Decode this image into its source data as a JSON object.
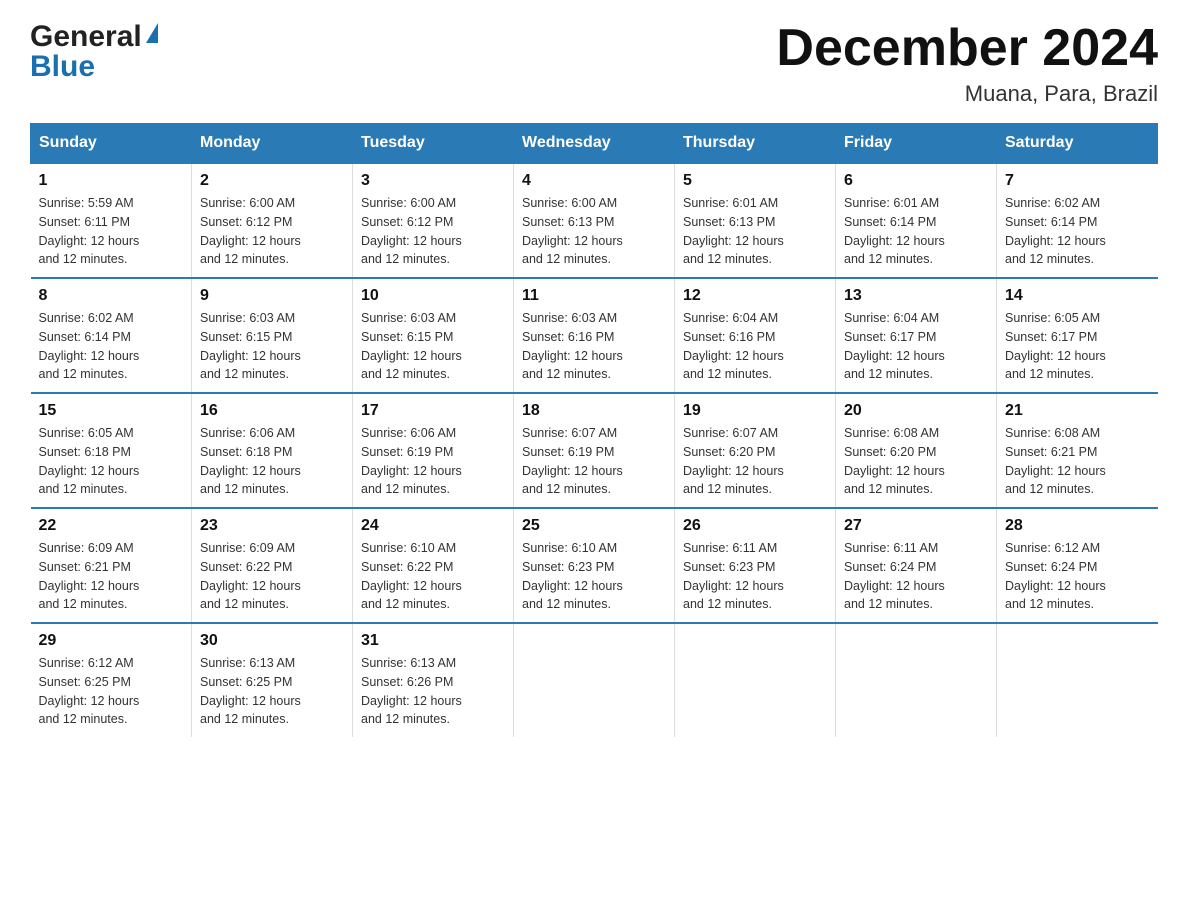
{
  "logo": {
    "line1": "General",
    "line2": "Blue"
  },
  "title": "December 2024",
  "subtitle": "Muana, Para, Brazil",
  "days_of_week": [
    "Sunday",
    "Monday",
    "Tuesday",
    "Wednesday",
    "Thursday",
    "Friday",
    "Saturday"
  ],
  "weeks": [
    [
      {
        "day": "1",
        "info": "Sunrise: 5:59 AM\nSunset: 6:11 PM\nDaylight: 12 hours\nand 12 minutes."
      },
      {
        "day": "2",
        "info": "Sunrise: 6:00 AM\nSunset: 6:12 PM\nDaylight: 12 hours\nand 12 minutes."
      },
      {
        "day": "3",
        "info": "Sunrise: 6:00 AM\nSunset: 6:12 PM\nDaylight: 12 hours\nand 12 minutes."
      },
      {
        "day": "4",
        "info": "Sunrise: 6:00 AM\nSunset: 6:13 PM\nDaylight: 12 hours\nand 12 minutes."
      },
      {
        "day": "5",
        "info": "Sunrise: 6:01 AM\nSunset: 6:13 PM\nDaylight: 12 hours\nand 12 minutes."
      },
      {
        "day": "6",
        "info": "Sunrise: 6:01 AM\nSunset: 6:14 PM\nDaylight: 12 hours\nand 12 minutes."
      },
      {
        "day": "7",
        "info": "Sunrise: 6:02 AM\nSunset: 6:14 PM\nDaylight: 12 hours\nand 12 minutes."
      }
    ],
    [
      {
        "day": "8",
        "info": "Sunrise: 6:02 AM\nSunset: 6:14 PM\nDaylight: 12 hours\nand 12 minutes."
      },
      {
        "day": "9",
        "info": "Sunrise: 6:03 AM\nSunset: 6:15 PM\nDaylight: 12 hours\nand 12 minutes."
      },
      {
        "day": "10",
        "info": "Sunrise: 6:03 AM\nSunset: 6:15 PM\nDaylight: 12 hours\nand 12 minutes."
      },
      {
        "day": "11",
        "info": "Sunrise: 6:03 AM\nSunset: 6:16 PM\nDaylight: 12 hours\nand 12 minutes."
      },
      {
        "day": "12",
        "info": "Sunrise: 6:04 AM\nSunset: 6:16 PM\nDaylight: 12 hours\nand 12 minutes."
      },
      {
        "day": "13",
        "info": "Sunrise: 6:04 AM\nSunset: 6:17 PM\nDaylight: 12 hours\nand 12 minutes."
      },
      {
        "day": "14",
        "info": "Sunrise: 6:05 AM\nSunset: 6:17 PM\nDaylight: 12 hours\nand 12 minutes."
      }
    ],
    [
      {
        "day": "15",
        "info": "Sunrise: 6:05 AM\nSunset: 6:18 PM\nDaylight: 12 hours\nand 12 minutes."
      },
      {
        "day": "16",
        "info": "Sunrise: 6:06 AM\nSunset: 6:18 PM\nDaylight: 12 hours\nand 12 minutes."
      },
      {
        "day": "17",
        "info": "Sunrise: 6:06 AM\nSunset: 6:19 PM\nDaylight: 12 hours\nand 12 minutes."
      },
      {
        "day": "18",
        "info": "Sunrise: 6:07 AM\nSunset: 6:19 PM\nDaylight: 12 hours\nand 12 minutes."
      },
      {
        "day": "19",
        "info": "Sunrise: 6:07 AM\nSunset: 6:20 PM\nDaylight: 12 hours\nand 12 minutes."
      },
      {
        "day": "20",
        "info": "Sunrise: 6:08 AM\nSunset: 6:20 PM\nDaylight: 12 hours\nand 12 minutes."
      },
      {
        "day": "21",
        "info": "Sunrise: 6:08 AM\nSunset: 6:21 PM\nDaylight: 12 hours\nand 12 minutes."
      }
    ],
    [
      {
        "day": "22",
        "info": "Sunrise: 6:09 AM\nSunset: 6:21 PM\nDaylight: 12 hours\nand 12 minutes."
      },
      {
        "day": "23",
        "info": "Sunrise: 6:09 AM\nSunset: 6:22 PM\nDaylight: 12 hours\nand 12 minutes."
      },
      {
        "day": "24",
        "info": "Sunrise: 6:10 AM\nSunset: 6:22 PM\nDaylight: 12 hours\nand 12 minutes."
      },
      {
        "day": "25",
        "info": "Sunrise: 6:10 AM\nSunset: 6:23 PM\nDaylight: 12 hours\nand 12 minutes."
      },
      {
        "day": "26",
        "info": "Sunrise: 6:11 AM\nSunset: 6:23 PM\nDaylight: 12 hours\nand 12 minutes."
      },
      {
        "day": "27",
        "info": "Sunrise: 6:11 AM\nSunset: 6:24 PM\nDaylight: 12 hours\nand 12 minutes."
      },
      {
        "day": "28",
        "info": "Sunrise: 6:12 AM\nSunset: 6:24 PM\nDaylight: 12 hours\nand 12 minutes."
      }
    ],
    [
      {
        "day": "29",
        "info": "Sunrise: 6:12 AM\nSunset: 6:25 PM\nDaylight: 12 hours\nand 12 minutes."
      },
      {
        "day": "30",
        "info": "Sunrise: 6:13 AM\nSunset: 6:25 PM\nDaylight: 12 hours\nand 12 minutes."
      },
      {
        "day": "31",
        "info": "Sunrise: 6:13 AM\nSunset: 6:26 PM\nDaylight: 12 hours\nand 12 minutes."
      },
      null,
      null,
      null,
      null
    ]
  ]
}
